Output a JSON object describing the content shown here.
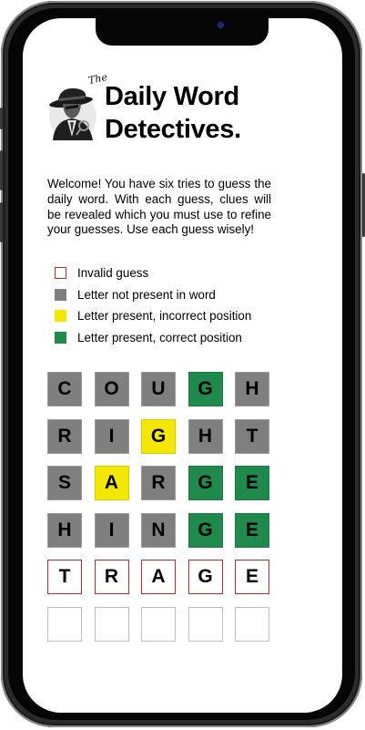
{
  "app": {
    "title_prefix": "The",
    "title": "Daily Word Detectives.",
    "logo_icon": "detective-icon"
  },
  "intro": "Welcome! You have six tries to guess the daily word. With each guess, clues will be revealed which you must use to refine your guesses. Use each guess wisely!",
  "legend": [
    {
      "label": "Invalid guess",
      "type": "invalid"
    },
    {
      "label": "Letter not present in word",
      "type": "gray"
    },
    {
      "label": "Letter present, incorrect position",
      "type": "yellow"
    },
    {
      "label": "Letter present, correct position",
      "type": "green"
    }
  ],
  "colors": {
    "gray": "#7f7f7f",
    "yellow": "#f5e800",
    "green": "#1f8a4c",
    "invalid_border": "#c62828"
  },
  "board": {
    "rows": [
      [
        {
          "letter": "C",
          "state": "gray"
        },
        {
          "letter": "O",
          "state": "gray"
        },
        {
          "letter": "U",
          "state": "gray"
        },
        {
          "letter": "G",
          "state": "green"
        },
        {
          "letter": "H",
          "state": "gray"
        }
      ],
      [
        {
          "letter": "R",
          "state": "gray"
        },
        {
          "letter": "I",
          "state": "gray"
        },
        {
          "letter": "G",
          "state": "yellow"
        },
        {
          "letter": "H",
          "state": "gray"
        },
        {
          "letter": "T",
          "state": "gray"
        }
      ],
      [
        {
          "letter": "S",
          "state": "gray"
        },
        {
          "letter": "A",
          "state": "yellow"
        },
        {
          "letter": "R",
          "state": "gray"
        },
        {
          "letter": "G",
          "state": "green"
        },
        {
          "letter": "E",
          "state": "green"
        }
      ],
      [
        {
          "letter": "H",
          "state": "gray"
        },
        {
          "letter": "I",
          "state": "gray"
        },
        {
          "letter": "N",
          "state": "gray"
        },
        {
          "letter": "G",
          "state": "green"
        },
        {
          "letter": "E",
          "state": "green"
        }
      ],
      [
        {
          "letter": "T",
          "state": "invalid"
        },
        {
          "letter": "R",
          "state": "invalid"
        },
        {
          "letter": "A",
          "state": "invalid"
        },
        {
          "letter": "G",
          "state": "invalid"
        },
        {
          "letter": "E",
          "state": "invalid"
        }
      ],
      [
        {
          "letter": "",
          "state": "empty"
        },
        {
          "letter": "",
          "state": "empty"
        },
        {
          "letter": "",
          "state": "empty"
        },
        {
          "letter": "",
          "state": "empty"
        },
        {
          "letter": "",
          "state": "empty"
        }
      ]
    ]
  }
}
